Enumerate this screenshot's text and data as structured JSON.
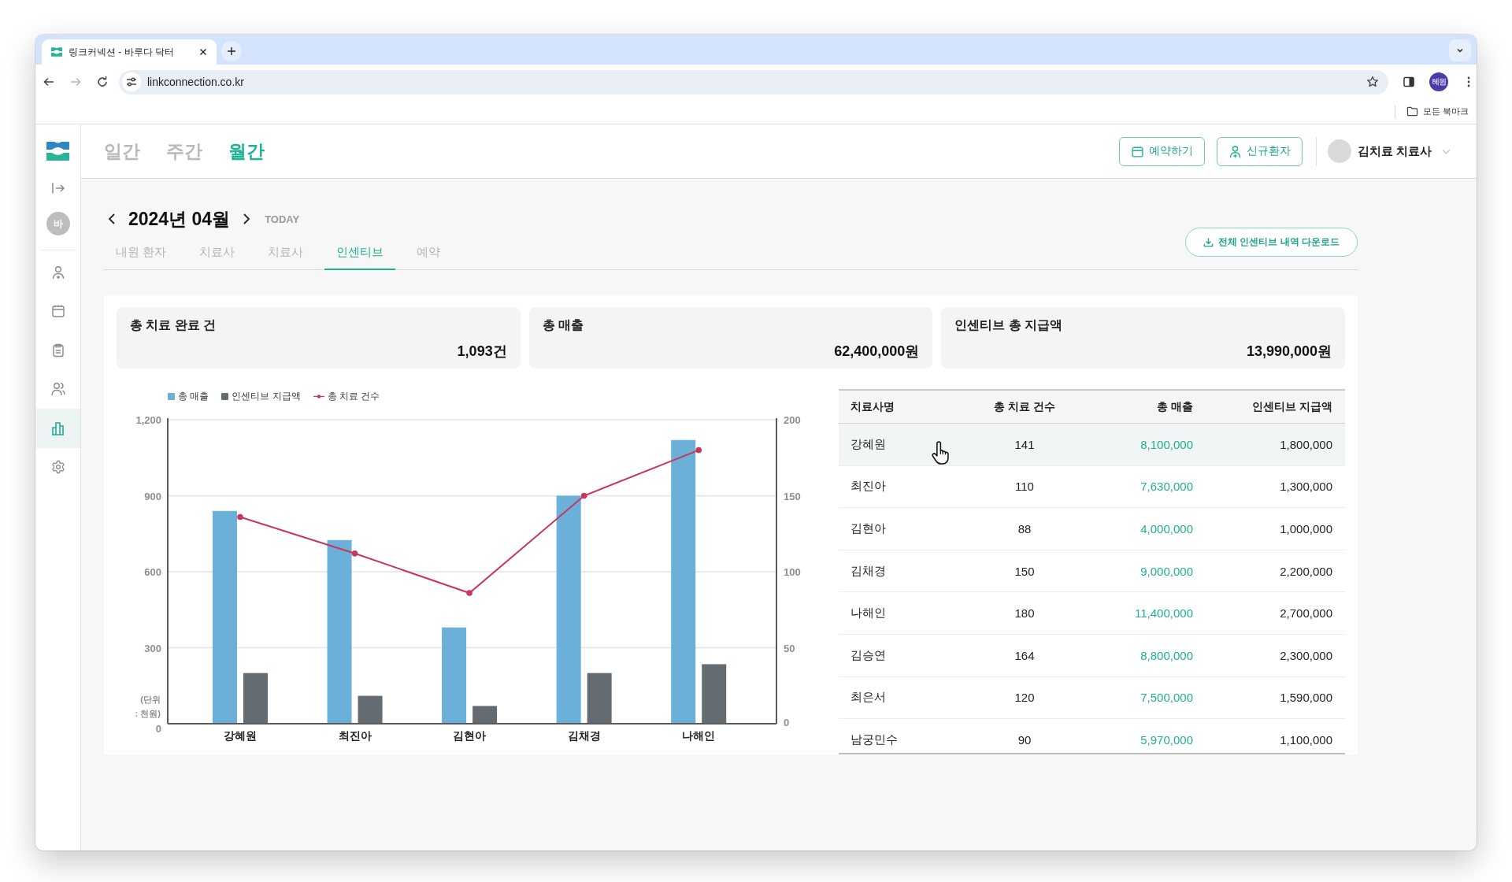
{
  "browser": {
    "tab_title": "링크커넥션 - 바루다 닥터",
    "url": "linkconnection.co.kr",
    "forward_disabled": true,
    "profile": "혜원",
    "bookmarks": "모든 북마크"
  },
  "sidebar": {
    "avatar": "바",
    "items": [
      {
        "kind": "patient",
        "selected": false
      },
      {
        "kind": "calendar",
        "selected": false
      },
      {
        "kind": "clipboard",
        "selected": false
      },
      {
        "kind": "staff",
        "selected": false
      },
      {
        "kind": "chart",
        "selected": true
      },
      {
        "kind": "settings",
        "selected": false
      }
    ]
  },
  "header": {
    "period_tabs": [
      {
        "label": "일간",
        "selected": false
      },
      {
        "label": "주간",
        "selected": false
      },
      {
        "label": "월간",
        "selected": true
      }
    ],
    "buttons": [
      {
        "kind": "calendar",
        "label": "예약하기"
      },
      {
        "kind": "person",
        "label": "신규환자"
      }
    ],
    "user": "김치료 치료사"
  },
  "month_nav": {
    "label": "2024년 04월",
    "today": "TODAY"
  },
  "tabs": [
    {
      "label": "내원 환자",
      "selected": false
    },
    {
      "label": "치료사",
      "selected": false
    },
    {
      "label": "치료사",
      "selected": false
    },
    {
      "label": "인센티브",
      "selected": true
    },
    {
      "label": "예약",
      "selected": false
    }
  ],
  "download_button": "전체 인센티브 내역 다운로드",
  "summary_cards": [
    {
      "label": "총 치료 완료 건",
      "value": "1,093건"
    },
    {
      "label": "총 매출",
      "value": "62,400,000원"
    },
    {
      "label": "인센티브 총 지급액",
      "value": "13,990,000원"
    }
  ],
  "chart": {
    "chart_data": {
      "type": "bar",
      "stacked": false,
      "grid": true,
      "legend": "top",
      "categories": [
        "강혜원",
        "최진아",
        "김현아",
        "김채경",
        "나해인"
      ],
      "series": [
        {
          "name": "총 매출",
          "color": "#6ab0d8",
          "values": [
            840,
            725,
            380,
            900,
            1120
          ]
        },
        {
          "name": "인센티브 지급액",
          "color": "#646c72",
          "values": [
            200,
            110,
            70,
            200,
            235
          ]
        },
        {
          "name": "총 치료 건수",
          "color": "#c8365e",
          "type": "line",
          "axis": "y2",
          "marker": "circle",
          "values": [
            136,
            112,
            86,
            150,
            180
          ]
        }
      ],
      "ylabel": "(단위 : 천원)",
      "ylim": [
        0,
        1200
      ],
      "yticks": [
        {
          "value": 0,
          "label": "0"
        },
        {
          "value": 300,
          "label": "300"
        },
        {
          "value": 600,
          "label": "600"
        },
        {
          "value": 900,
          "label": "900"
        },
        {
          "value": 1200,
          "label": "1,200"
        }
      ],
      "y2lim": [
        0,
        200
      ],
      "y2ticks": [
        0,
        50,
        100,
        150,
        200
      ]
    }
  },
  "table": {
    "columns": [
      "치료사명",
      "총 치료 건수",
      "총 매출",
      "인센티브 지급액"
    ],
    "rows": [
      {
        "cells": [
          "강혜원",
          "141",
          "8,100,000",
          "1,800,000"
        ],
        "selected": true
      },
      {
        "cells": [
          "최진아",
          "110",
          "7,630,000",
          "1,300,000"
        ],
        "selected": false
      },
      {
        "cells": [
          "김현아",
          "88",
          "4,000,000",
          "1,000,000"
        ],
        "selected": false
      },
      {
        "cells": [
          "김채경",
          "150",
          "9,000,000",
          "2,200,000"
        ],
        "selected": false
      },
      {
        "cells": [
          "나해인",
          "180",
          "11,400,000",
          "2,700,000"
        ],
        "selected": false
      },
      {
        "cells": [
          "김승연",
          "164",
          "8,800,000",
          "2,300,000"
        ],
        "selected": false
      },
      {
        "cells": [
          "최은서",
          "120",
          "7,500,000",
          "1,590,000"
        ],
        "selected": false
      },
      {
        "cells": [
          "남궁민수",
          "90",
          "5,970,000",
          "1,100,000"
        ],
        "selected": false
      }
    ]
  }
}
